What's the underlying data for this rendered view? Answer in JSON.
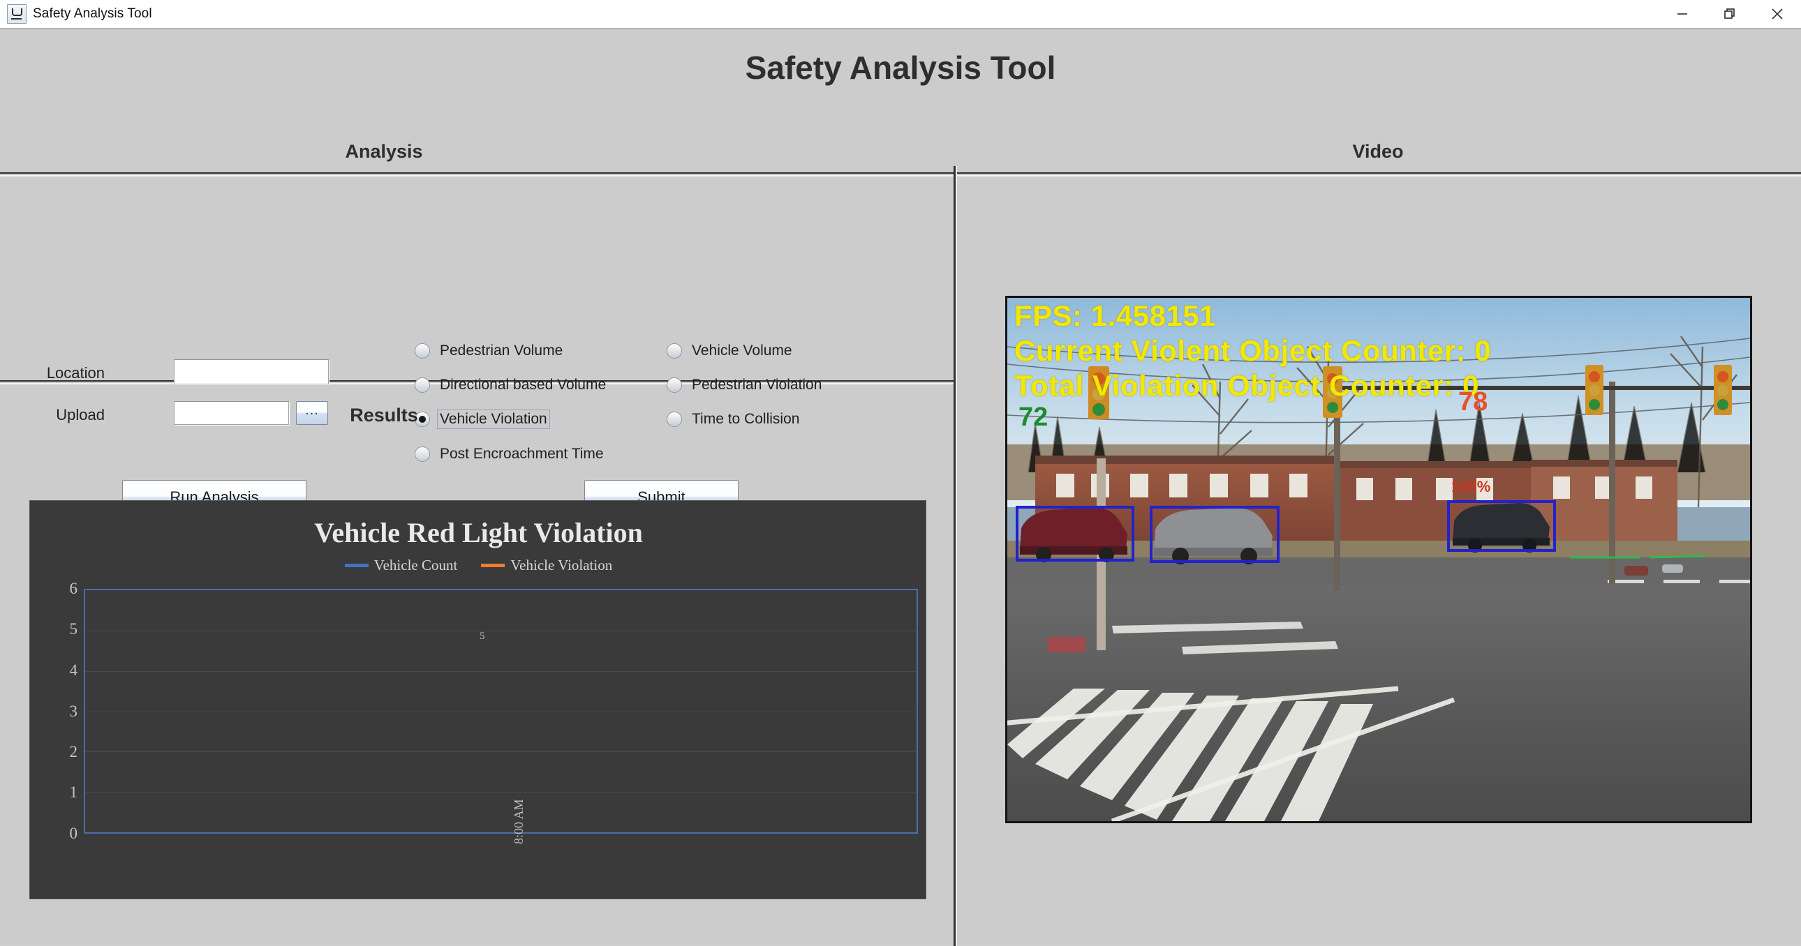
{
  "window": {
    "title": "Safety Analysis Tool",
    "app_icon": "java-coffee-cup-icon",
    "controls": {
      "minimize": "minimize-icon",
      "restore": "restore-icon",
      "close": "close-icon"
    }
  },
  "app": {
    "title": "Safety Analysis Tool"
  },
  "panes": {
    "analysis_header": "Analysis",
    "video_header": "Video",
    "results_header": "Results"
  },
  "form": {
    "location_label": "Location",
    "location_value": "",
    "location_placeholder": "",
    "upload_label": "Upload",
    "upload_value": "",
    "upload_placeholder": "",
    "browse_label": "...",
    "run_label": "Run Analysis",
    "submit_label": "Submit"
  },
  "analysis_options": [
    {
      "id": "pedestrian-volume",
      "label": "Pedestrian Volume",
      "selected": false
    },
    {
      "id": "vehicle-volume",
      "label": "Vehicle Volume",
      "selected": false
    },
    {
      "id": "directional-based-volume",
      "label": "Directional based Volume",
      "selected": false
    },
    {
      "id": "pedestrian-violation",
      "label": "Pedestrian Violation",
      "selected": false
    },
    {
      "id": "vehicle-violation",
      "label": "Vehicle Violation",
      "selected": true
    },
    {
      "id": "time-to-collision",
      "label": "Time to Collision",
      "selected": false
    },
    {
      "id": "post-encroachment-time",
      "label": "Post Encroachment Time",
      "selected": false
    }
  ],
  "chart_data": {
    "type": "line",
    "title": "Vehicle Red Light Violation",
    "xlabel": "",
    "ylabel": "",
    "categories": [
      "8:00 AM"
    ],
    "x": [
      "8:00 AM"
    ],
    "series": [
      {
        "name": "Vehicle Count",
        "color": "#4472c4",
        "values": [
          5
        ]
      },
      {
        "name": "Vehicle Violation",
        "color": "#ed7d31",
        "values": [
          0
        ]
      }
    ],
    "legend": [
      "Vehicle Count",
      "Vehicle Violation"
    ],
    "legend_position": "top",
    "ylim": [
      0,
      6
    ],
    "yticks": [
      0,
      1,
      2,
      3,
      4,
      5,
      6
    ],
    "grid": true,
    "data_labels": [
      "5"
    ],
    "background": "#3a3a3a",
    "plot_border_color": "#4b6ea9"
  },
  "video": {
    "overlay": {
      "fps": "FPS: 1.458151",
      "current_counter": "Current Violent Object Counter: 0",
      "total_counter": "Total Violation Object Counter: 0"
    },
    "detections": [
      {
        "id": "signal-left",
        "label": "72",
        "color": "#1e8b2e"
      },
      {
        "id": "signal-right",
        "label": "78",
        "color": "#e8502a"
      },
      {
        "id": "car-right",
        "label": "100%",
        "color": "#c8361f"
      }
    ],
    "box_color": "#2222cc"
  },
  "colors": {
    "panel": "#cccccc",
    "accent_blue": "#4472c4",
    "accent_orange": "#ed7d31",
    "overlay_yellow": "#f2e800"
  }
}
